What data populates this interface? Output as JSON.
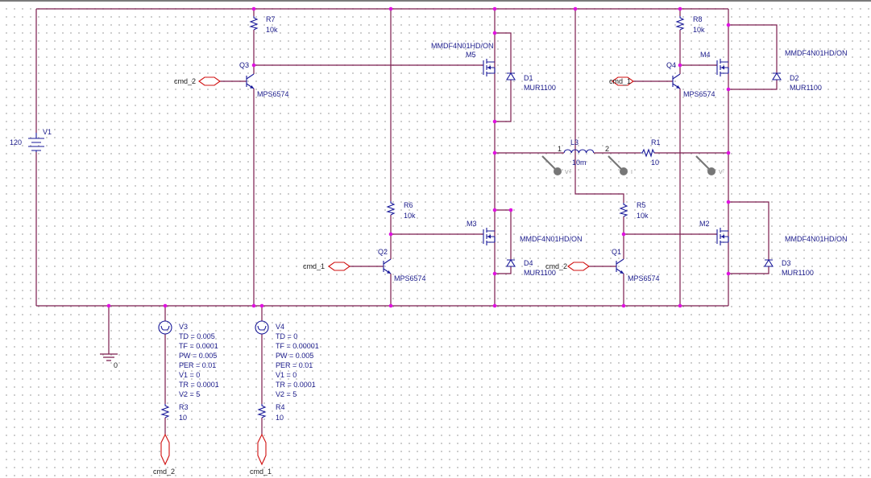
{
  "schematic": {
    "V1": {
      "ref": "V1",
      "value": "120"
    },
    "R7": {
      "ref": "R7",
      "value": "10k"
    },
    "R8": {
      "ref": "R8",
      "value": "10k"
    },
    "R6": {
      "ref": "R6",
      "value": "10k"
    },
    "R5": {
      "ref": "R5",
      "value": "10k"
    },
    "R1": {
      "ref": "R1",
      "value": "10"
    },
    "R3": {
      "ref": "R3",
      "value": "10"
    },
    "R4": {
      "ref": "R4",
      "value": "10"
    },
    "L3": {
      "ref": "L3",
      "value": "10m",
      "pin1": "1",
      "pin2": "2"
    },
    "Q1": {
      "ref": "Q1",
      "model": "MPS6574"
    },
    "Q2": {
      "ref": "Q2",
      "model": "MPS6574"
    },
    "Q3": {
      "ref": "Q3",
      "model": "MPS6574"
    },
    "Q4": {
      "ref": "Q4",
      "model": "MPS6574"
    },
    "M2": {
      "ref": "M2",
      "model": "MMDF4N01HD/ON"
    },
    "M3": {
      "ref": "M3",
      "model": "MMDF4N01HD/ON"
    },
    "M4": {
      "ref": "M4",
      "model": "MMDF4N01HD/ON"
    },
    "M5": {
      "ref": "M5",
      "model": "MMDF4N01HD/ON"
    },
    "D1": {
      "ref": "D1",
      "model": "MUR1100"
    },
    "D2": {
      "ref": "D2",
      "model": "MUR1100"
    },
    "D3": {
      "ref": "D3",
      "model": "MUR1100"
    },
    "D4": {
      "ref": "D4",
      "model": "MUR1100"
    },
    "V3": {
      "ref": "V3",
      "params": [
        "TD = 0.005",
        "TF = 0.0001",
        "PW = 0.005",
        "PER = 0.01",
        "V1 = 0",
        "TR = 0.0001",
        "V2 = 5"
      ]
    },
    "V4": {
      "ref": "V4",
      "params": [
        "TD = 0",
        "TF = 0.00001",
        "PW = 0.005",
        "PER = 0.01",
        "V1 = 0",
        "TR = 0.0001",
        "V2 = 5"
      ]
    },
    "ground": "0",
    "ports": {
      "cmd_1": "cmd_1",
      "cmd_2": "cmd_2"
    },
    "probes": {
      "voltage_plus": "V+",
      "current": "I",
      "voltage_minus": "V-"
    }
  },
  "colors": {
    "wire": "#7b1c4e",
    "part": "#1a1a9a",
    "port": "#d01010",
    "junction": "#e010e0",
    "probe": "#777777"
  }
}
